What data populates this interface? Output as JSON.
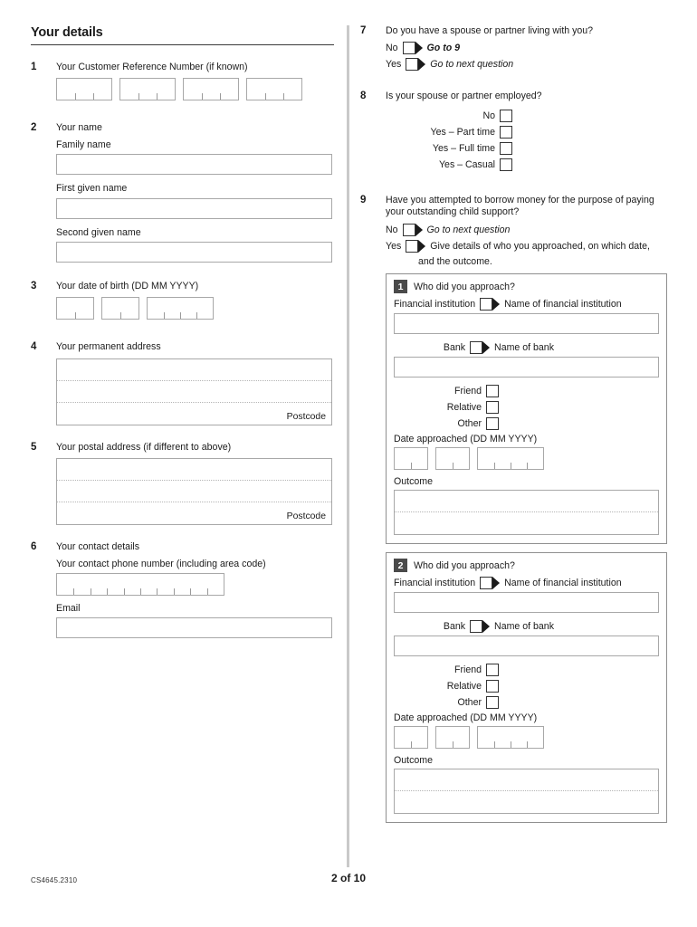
{
  "document": {
    "form_code": "CS4645.2310",
    "page_indicator": "2 of 10"
  },
  "left_column": {
    "section_title": "Your details",
    "questions": [
      {
        "number": "1",
        "text": "Your Customer Reference Number (if known)",
        "field_type": "segmented-boxes",
        "groups": [
          3,
          3,
          3,
          3
        ]
      },
      {
        "number": "2",
        "text": "Your name",
        "fields": [
          {
            "label": "Family name",
            "value": ""
          },
          {
            "label": "First given name",
            "value": ""
          },
          {
            "label": "Second given name",
            "value": ""
          }
        ]
      },
      {
        "number": "3",
        "text": "Your date of birth (DD MM YYYY)",
        "field_type": "date-boxes",
        "groups": [
          2,
          2,
          4
        ]
      },
      {
        "number": "4",
        "text": "Your permanent address",
        "field_type": "address",
        "postcode_label": "Postcode"
      },
      {
        "number": "5",
        "text": "Your postal address (if different to above)",
        "field_type": "address",
        "postcode_label": "Postcode"
      },
      {
        "number": "6",
        "text": "Your contact details",
        "phone_label": "Your contact phone number (including area code)",
        "phone_cells": 10,
        "email_label": "Email",
        "email_value": ""
      }
    ]
  },
  "right_column": {
    "questions": [
      {
        "number": "7",
        "text": "Do you have a spouse or partner living with you?",
        "options": [
          {
            "label": "No",
            "arrow": true,
            "after": "Go to 9",
            "style": "bold-italic"
          },
          {
            "label": "Yes",
            "arrow": true,
            "after": "Go to next question",
            "style": "italic"
          }
        ]
      },
      {
        "number": "8",
        "text": "Is your spouse or partner employed?",
        "options": [
          {
            "label": "No"
          },
          {
            "label": "Yes – Part time"
          },
          {
            "label": "Yes – Full time"
          },
          {
            "label": "Yes – Casual"
          }
        ]
      },
      {
        "number": "9",
        "text": "Have you attempted to borrow money for the purpose of paying your outstanding child support?",
        "options": [
          {
            "label": "No",
            "arrow": true,
            "after": "Go to next question",
            "style": "italic"
          },
          {
            "label": "Yes",
            "arrow": true,
            "after": "Give details of who you approached, on which date,",
            "style": "plain",
            "after_line2": "and the outcome."
          }
        ],
        "panels": [
          {
            "badge": "1",
            "title": "Who did you approach?",
            "financial_label": "Financial institution",
            "financial_after": "Name of financial institution",
            "financial_value": "",
            "bank_label": "Bank",
            "bank_after": "Name of bank",
            "bank_value": "",
            "simple_options": [
              "Friend",
              "Relative",
              "Other"
            ],
            "date_label": "Date approached (DD MM YYYY)",
            "date_groups": [
              2,
              2,
              4
            ],
            "outcome_label": "Outcome",
            "outcome_value": ""
          },
          {
            "badge": "2",
            "title": "Who did you approach?",
            "financial_label": "Financial institution",
            "financial_after": "Name of financial institution",
            "financial_value": "",
            "bank_label": "Bank",
            "bank_after": "Name of bank",
            "bank_value": "",
            "simple_options": [
              "Friend",
              "Relative",
              "Other"
            ],
            "date_label": "Date approached (DD MM YYYY)",
            "date_groups": [
              2,
              2,
              4
            ],
            "outcome_label": "Outcome",
            "outcome_value": ""
          }
        ]
      }
    ]
  }
}
